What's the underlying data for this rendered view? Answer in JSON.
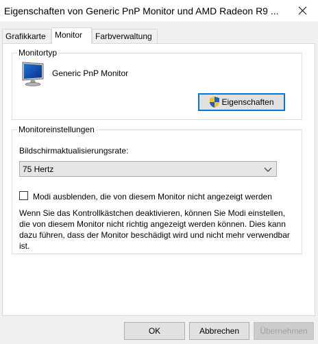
{
  "window": {
    "title": "Eigenschaften von Generic PnP Monitor und AMD Radeon R9 ...",
    "close_icon": "close-icon"
  },
  "tabs": [
    {
      "label": "Grafikkarte",
      "active": false
    },
    {
      "label": "Monitor",
      "active": true
    },
    {
      "label": "Farbverwaltung",
      "active": false
    }
  ],
  "monitor_type": {
    "legend": "Monitortyp",
    "icon": "monitor-icon",
    "name": "Generic PnP Monitor",
    "properties_button": "Eigenschaften",
    "button_icon": "shield-icon"
  },
  "monitor_settings": {
    "legend": "Monitoreinstellungen",
    "refresh_label": "Bildschirmaktualisierungsrate:",
    "refresh_value": "75 Hertz",
    "hide_modes_label": "Modi ausblenden, die von diesem Monitor nicht angezeigt werden",
    "hide_modes_checked": false,
    "description": "Wenn Sie das Kontrollkästchen deaktivieren, können Sie Modi einstellen, die von diesem Monitor nicht richtig angezeigt werden können. Dies kann dazu führen, dass der Monitor beschädigt wird und nicht mehr verwendbar ist."
  },
  "buttons": {
    "ok": "OK",
    "cancel": "Abbrechen",
    "apply": "Übernehmen"
  },
  "colors": {
    "accent": "#0078d7",
    "dialog_bg": "#f0f0f0"
  }
}
